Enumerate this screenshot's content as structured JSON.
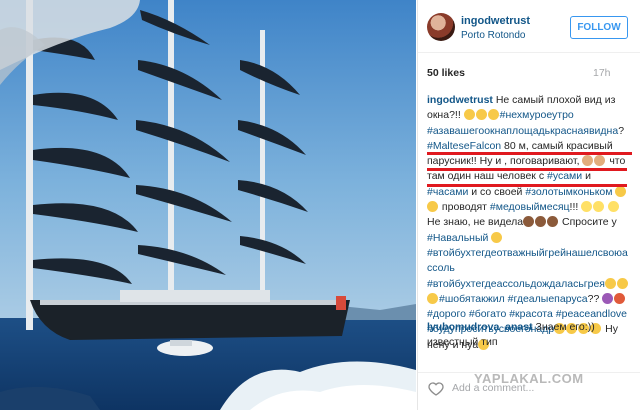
{
  "post": {
    "username": "ingodwetrust",
    "location": "Porto Rotondo",
    "follow_label": "FOLLOW",
    "likes": "50 likes",
    "age": "17h"
  },
  "caption": {
    "username": "ingodwetrust",
    "t1": "Не самый плохой вид из окна?!! ",
    "tag1": "#нехмуроеутро",
    "tag2": "#азавашегоокнаплощадькраснаявидна",
    "t2": "? ",
    "tag3": "#MalteseFalcon",
    "t3": " 80 м, самый красивый парусник!! Ну и , поговаривают, ",
    "t4": "что там один наш человек с ",
    "tag4": "#усами",
    "t5": " и ",
    "tag5": "#часами",
    "t6": " и со своей ",
    "tag6": "#золотымконьком",
    "t7": " проводят ",
    "tag7": "#медовыймесяц",
    "t8": "!!! ",
    "t9": " Не знаю, не видела",
    "t10": " Спросите у ",
    "tag8": "#Навальный",
    "tag9": "#втойбухтегдеотважныйгрейнашелсвоюассоль",
    "tag10": "#втойбухтегдеассольдождаласьгрея",
    "tag11": "#шобятакжил",
    "tag12": "#гдеалыепаруса",
    "t11": "??",
    "tag13": "#дорого",
    "tag14": "#богато",
    "tag15": "#красота",
    "tag16": "#peaceandlove",
    "tag17": "#будупроситьусвоегонадр",
    "t12": "Ну нену и нуа"
  },
  "comment": {
    "username": "lyubomudrova_anast",
    "text": " Знаем его:)) известный тип"
  },
  "footer": {
    "add_comment_placeholder": "Add a comment..."
  },
  "watermark": "YAPLAKAL.COM"
}
